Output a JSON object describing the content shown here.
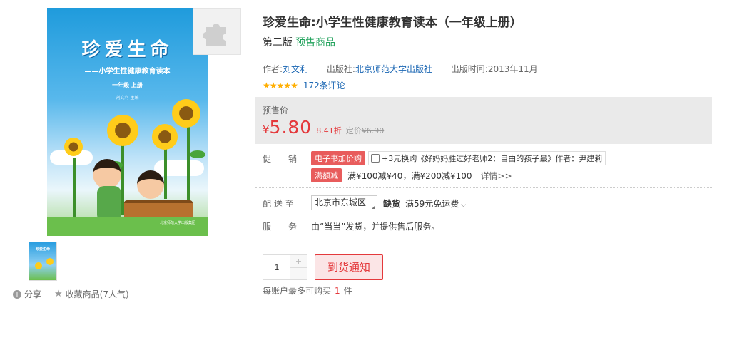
{
  "product": {
    "title": "珍爱生命:小学生性健康教育读本（一年级上册）",
    "edition": "第二版",
    "presale_tag": "预售商品",
    "author_label": "作者:",
    "author": "刘文利",
    "publisher_label": "出版社:",
    "publisher": "北京师范大学出版社",
    "pub_date_label": "出版时间:",
    "pub_date": "2013年11月",
    "rating_stars": 5,
    "review_count": "172",
    "review_suffix": "条评论"
  },
  "cover": {
    "title": "珍爱生命",
    "subtitle": "——小学生性健康教育读本",
    "grade": "一年级  上册",
    "editor": "刘文利  主编",
    "publisher_mark": "北京师范大学出版集团"
  },
  "gallery": {
    "thumb_title": "珍爱生命",
    "share": "分享",
    "favorite": "收藏商品(7人气)"
  },
  "price": {
    "label": "预售价",
    "currency": "¥",
    "value": "5.80",
    "discount": "8.41折",
    "original_label": "定价",
    "original": "¥6.90"
  },
  "promotion": {
    "label": "促　　销",
    "tag1": "电子书加价购",
    "tag1_text": "+3元换购《好妈妈胜过好老师2：自由的孩子最》作者：尹建莉",
    "tag2": "满额减",
    "tag2_text": "满¥100减¥40，满¥200减¥100",
    "more": "详情>>"
  },
  "delivery": {
    "label": "配 送 至",
    "destination": "北京市东城区",
    "stock": "缺货",
    "shipping": "满59元免运费",
    "service_label": "服　　务",
    "service_text": "由“当当”发货，并提供售后服务。"
  },
  "purchase": {
    "quantity": "1",
    "plus": "+",
    "minus": "−",
    "notify_button": "到货通知",
    "limit_prefix": "每账户最多可购买",
    "limit_num": "1",
    "limit_suffix": "件"
  },
  "colors": {
    "accent_red": "#e4393c",
    "presale_green": "#1fa15a",
    "link_blue": "#1a66b3",
    "star_gold": "#ffae00"
  },
  "icons": {
    "share": "plus-circle-icon",
    "favorite": "star-icon",
    "placeholder": "puzzle-icon"
  }
}
